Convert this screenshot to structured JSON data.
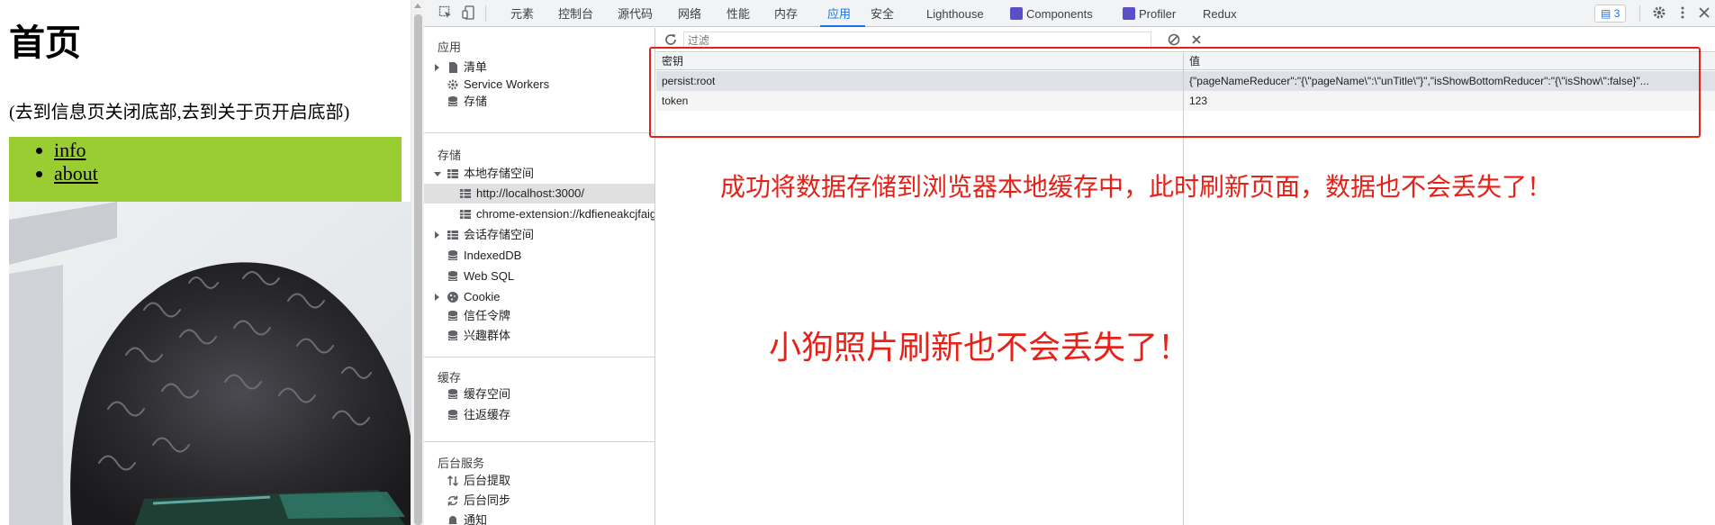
{
  "page": {
    "title": "首页",
    "description": "(去到信息页关闭底部,去到关于页开启底部)",
    "nav_links": [
      "info",
      "about"
    ],
    "nav_background": "#9acd32"
  },
  "devtools": {
    "tabs": [
      {
        "label": "元素",
        "active": false
      },
      {
        "label": "控制台",
        "active": false
      },
      {
        "label": "源代码",
        "active": false
      },
      {
        "label": "网络",
        "active": false
      },
      {
        "label": "性能",
        "active": false
      },
      {
        "label": "内存",
        "active": false
      },
      {
        "label": "应用",
        "active": true
      },
      {
        "label": "安全",
        "active": false
      },
      {
        "label": "Lighthouse",
        "active": false
      },
      {
        "label": "Components",
        "active": false
      },
      {
        "label": "Profiler",
        "active": false
      },
      {
        "label": "Redux",
        "active": false
      }
    ],
    "issues_count": "3",
    "sidebar": {
      "app_section": "应用",
      "manifest": "清单",
      "service_workers": "Service Workers",
      "storage_overview": "存储",
      "storage_section": "存储",
      "local_storage": "本地存储空间",
      "local_origin_1": "http://localhost:3000/",
      "local_origin_2": "chrome-extension://kdfieneakcjfaiglcfcgkidlkmlijjnh",
      "session_storage": "会话存储空间",
      "indexeddb": "IndexedDB",
      "websql": "Web SQL",
      "cookie": "Cookie",
      "trust_tokens": "信任令牌",
      "interest_groups": "兴趣群体",
      "cache_section": "缓存",
      "cache_storage": "缓存空间",
      "back_forward_cache": "往返缓存",
      "background_section": "后台服务",
      "background_fetch": "后台提取",
      "background_sync": "后台同步",
      "notifications": "通知"
    },
    "filter": {
      "placeholder": "过滤"
    },
    "table": {
      "headers": {
        "key": "密钥",
        "value": "值"
      },
      "rows": [
        {
          "key": "persist:root",
          "value": "{\"pageNameReducer\":\"{\\\"pageName\\\":\\\"unTitle\\\"}\",\"isShowBottomReducer\":\"{\\\"isShow\\\":false}\"..."
        },
        {
          "key": "token",
          "value": "123"
        }
      ]
    }
  },
  "annotations": {
    "text_1": "成功将数据存储到浏览器本地缓存中，此时刷新页面，数据也不会丢失了！",
    "text_2": "小狗照片刷新也不会丢失了！",
    "color": "#e62117"
  }
}
